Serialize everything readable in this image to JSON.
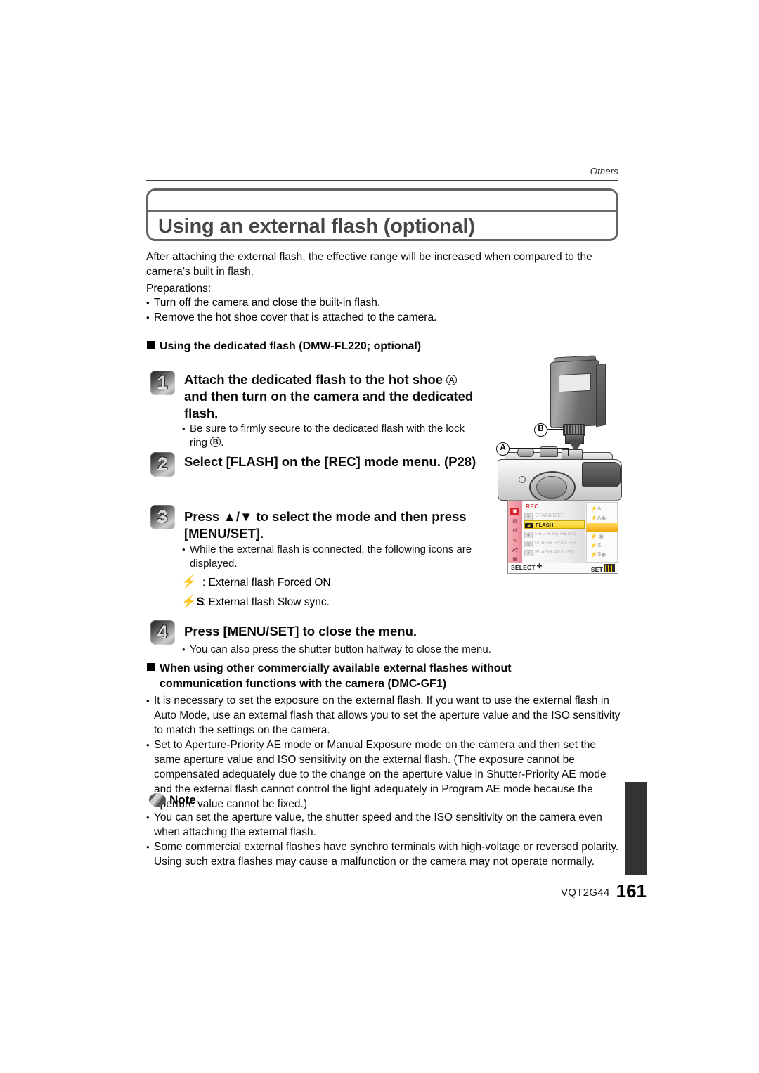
{
  "header": {
    "running_head": "Others"
  },
  "title": {
    "text": "Using an external flash (optional)"
  },
  "intro": {
    "paragraph": "After attaching the external flash, the effective range will be increased when compared to the camera’s built in flash.",
    "prep_label": "Preparations:",
    "prep_items": [
      "Turn off the camera and close the built-in flash.",
      "Remove the hot shoe cover that is attached to the camera."
    ]
  },
  "sections": {
    "dedicated_flash_heading": "Using the dedicated flash (DMW-FL220; optional)",
    "other_flashes_heading_line1": "When using other commercially available external flashes without",
    "other_flashes_heading_line2": "communication functions with the camera (DMC-GF1)"
  },
  "steps": [
    {
      "number": "1",
      "title_line1": "Attach the dedicated flash to the hot shoe",
      "title_callout1": "A",
      "title_line2": "and then turn on the camera and the dedicated",
      "title_line3": "flash.",
      "sub_line1": "Be sure to firmly secure to the dedicated flash with the lock",
      "sub_line2": "ring",
      "sub_callout": "B",
      "sub_line2_tail": "."
    },
    {
      "number": "2",
      "title_line1": "Select [FLASH] on the [REC] mode menu. (P28)"
    },
    {
      "number": "3",
      "title_line1": "Press ▲/▼ to select the mode and then press",
      "title_line2": "[MENU/SET].",
      "sub_line1": "While the external flash is connected, the following icons are",
      "sub_line2": "displayed.",
      "icon_rows": [
        {
          "glyph": "⚡",
          "label": ":   External flash Forced ON"
        },
        {
          "glyph": "⚡S",
          "label": ": External flash Slow sync."
        }
      ]
    },
    {
      "number": "4",
      "title_line1": "Press [MENU/SET] to close the menu.",
      "sub_line1": "You can also press the shutter button halfway to close the menu."
    }
  ],
  "other_flash_bullets": [
    "It is necessary to set the exposure on the external flash. If you want to use the external flash in Auto Mode, use an external flash that allows you to set the aperture value and the ISO sensitivity to match the settings on the camera.",
    "Set to Aperture-Priority AE mode or Manual Exposure mode on the camera and then set the same aperture value and ISO sensitivity on the external flash. (The exposure cannot be compensated adequately due to the change on the aperture value in Shutter-Priority AE mode and the external flash cannot control the light adequately in Program AE mode because the aperture value cannot be fixed.)"
  ],
  "note": {
    "heading": "Note",
    "bullets": [
      "You can set the aperture value, the shutter speed and the ISO sensitivity on the camera even when attaching the external flash.",
      "Some commercial external flashes have synchro terminals with high-voltage or reversed polarity. Using such extra flashes may cause a malfunction or the camera may not operate normally."
    ]
  },
  "illustration": {
    "callout_a": "A",
    "callout_b": "B"
  },
  "menu_screenshot": {
    "title": "REC",
    "left_icons": [
      "▣",
      "▤",
      "cf",
      "✎",
      "wT",
      "▦"
    ],
    "rows": [
      {
        "icon": "✻",
        "label": "STABILIZER",
        "selected": false
      },
      {
        "icon": "⚡",
        "label": "FLASH",
        "selected": true
      },
      {
        "icon": "◉",
        "label": "RED-EYE REMO",
        "selected": false
      },
      {
        "icon": "▥",
        "label": "FLASH SYNCHR",
        "selected": false
      },
      {
        "icon": "±",
        "label": "FLASH ADJUST.",
        "selected": false
      }
    ],
    "options": [
      {
        "label": "⚡A",
        "selected": false
      },
      {
        "label": "⚡A◉",
        "selected": false
      },
      {
        "label": "⚡",
        "selected": true
      },
      {
        "label": "⚡ ◉",
        "selected": false
      },
      {
        "label": "⚡S",
        "selected": false
      },
      {
        "label": "⚡S◉",
        "selected": false
      }
    ],
    "select_label": "SELECT",
    "set_label": "SET"
  },
  "footer": {
    "doc_code": "VQT2G44",
    "page_number": "161"
  }
}
